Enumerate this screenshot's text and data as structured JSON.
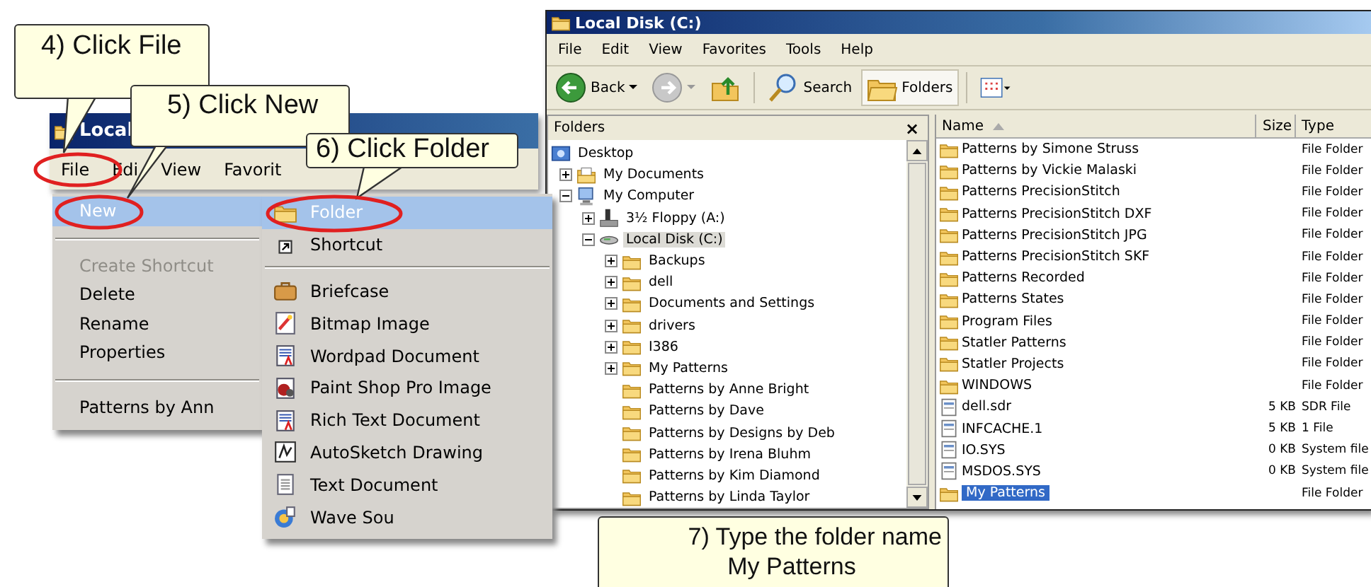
{
  "left_window": {
    "title": "Local",
    "menu": [
      {
        "label": "File"
      },
      {
        "label": "Edi"
      },
      {
        "label": "View"
      },
      {
        "label": "Favorit"
      }
    ],
    "file_menu": [
      {
        "kind": "item",
        "label": "New",
        "selected": true,
        "disabled": false
      },
      {
        "kind": "separator"
      },
      {
        "kind": "item",
        "label": "Create Shortcut",
        "selected": false,
        "disabled": true
      },
      {
        "kind": "item",
        "label": "Delete",
        "selected": false,
        "disabled": false
      },
      {
        "kind": "item",
        "label": "Rename",
        "selected": false,
        "disabled": false
      },
      {
        "kind": "item",
        "label": "Properties",
        "selected": false,
        "disabled": false
      },
      {
        "kind": "separator"
      },
      {
        "kind": "item",
        "label": "Patterns by Ann",
        "selected": false,
        "disabled": false
      }
    ],
    "new_submenu": [
      {
        "kind": "folder",
        "label": "Folder",
        "selected": true
      },
      {
        "kind": "shortcut",
        "label": "Shortcut",
        "selected": false
      },
      {
        "kind": "separator"
      },
      {
        "kind": "briefcase",
        "label": "Briefcase",
        "selected": false
      },
      {
        "kind": "bitmap",
        "label": "Bitmap Image",
        "selected": false
      },
      {
        "kind": "document",
        "label": "Wordpad Document",
        "selected": false
      },
      {
        "kind": "paint",
        "label": "Paint Shop Pro Image",
        "selected": false
      },
      {
        "kind": "document",
        "label": "Rich Text Document",
        "selected": false
      },
      {
        "kind": "sketch",
        "label": "AutoSketch Drawing",
        "selected": false
      },
      {
        "kind": "text",
        "label": "Text Document",
        "selected": false
      },
      {
        "kind": "wave",
        "label": "Wave Sou",
        "selected": false
      }
    ]
  },
  "right_window": {
    "title": "Local Disk (C:)",
    "menu": [
      {
        "label": "File"
      },
      {
        "label": "Edit"
      },
      {
        "label": "View"
      },
      {
        "label": "Favorites"
      },
      {
        "label": "Tools"
      },
      {
        "label": "Help"
      }
    ],
    "toolbar": [
      {
        "kind": "back",
        "label": "Back",
        "pressed": false
      },
      {
        "kind": "forward",
        "pressed": false
      },
      {
        "kind": "up",
        "pressed": false
      },
      {
        "kind": "search",
        "label": "Search",
        "pressed": false
      },
      {
        "kind": "folders",
        "label": "Folders",
        "pressed": true
      },
      {
        "kind": "views",
        "pressed": false
      }
    ],
    "folders_pane": {
      "title": "Folders",
      "close": "×",
      "tree": [
        {
          "label": "Desktop",
          "kind": "desktop",
          "selected": false,
          "children": [
            {
              "label": "My Documents",
              "kind": "documents",
              "expanded": false,
              "selected": false
            },
            {
              "label": "My Computer",
              "kind": "computer",
              "expanded": true,
              "selected": false,
              "children": [
                {
                  "label": "3½ Floppy (A:)",
                  "kind": "floppy",
                  "expanded": false,
                  "selected": false
                },
                {
                  "label": "Local Disk (C:)",
                  "kind": "drive",
                  "expanded": true,
                  "selected": true,
                  "children": [
                    {
                      "label": "Backups",
                      "kind": "folder",
                      "expanded": false,
                      "selected": false
                    },
                    {
                      "label": "dell",
                      "kind": "folder",
                      "expanded": false,
                      "selected": false
                    },
                    {
                      "label": "Documents and Settings",
                      "kind": "folder",
                      "expanded": false,
                      "selected": false
                    },
                    {
                      "label": "drivers",
                      "kind": "folder",
                      "expanded": false,
                      "selected": false
                    },
                    {
                      "label": "I386",
                      "kind": "folder",
                      "expanded": false,
                      "selected": false
                    },
                    {
                      "label": "My Patterns",
                      "kind": "folder",
                      "expanded": false,
                      "selected": false
                    },
                    {
                      "label": "Patterns by Anne Bright",
                      "kind": "folder",
                      "selected": false
                    },
                    {
                      "label": "Patterns by Dave",
                      "kind": "folder",
                      "selected": false
                    },
                    {
                      "label": "Patterns by Designs by Deb",
                      "kind": "folder",
                      "selected": false
                    },
                    {
                      "label": "Patterns by Irena Bluhm",
                      "kind": "folder",
                      "selected": false
                    },
                    {
                      "label": "Patterns by Kim Diamond",
                      "kind": "folder",
                      "selected": false
                    },
                    {
                      "label": "Patterns by Linda Taylor",
                      "kind": "folder",
                      "selected": false
                    }
                  ]
                }
              ]
            }
          ]
        }
      ]
    },
    "file_list": {
      "columns": [
        {
          "label": "Name",
          "sorted": true
        },
        {
          "label": "Size",
          "sorted": false
        },
        {
          "label": "Type",
          "sorted": false
        }
      ],
      "rows": [
        {
          "kind": "folder",
          "name": "Patterns by Simone Struss",
          "type": "File Folder",
          "selected": false
        },
        {
          "kind": "folder",
          "name": "Patterns by Vickie Malaski",
          "type": "File Folder",
          "selected": false
        },
        {
          "kind": "folder",
          "name": "Patterns PrecisionStitch",
          "type": "File Folder",
          "selected": false
        },
        {
          "kind": "folder",
          "name": "Patterns PrecisionStitch DXF",
          "type": "File Folder",
          "selected": false
        },
        {
          "kind": "folder",
          "name": "Patterns PrecisionStitch JPG",
          "type": "File Folder",
          "selected": false
        },
        {
          "kind": "folder",
          "name": "Patterns PrecisionStitch SKF",
          "type": "File Folder",
          "selected": false
        },
        {
          "kind": "folder",
          "name": "Patterns Recorded",
          "type": "File Folder",
          "selected": false
        },
        {
          "kind": "folder",
          "name": "Patterns States",
          "type": "File Folder",
          "selected": false
        },
        {
          "kind": "folder",
          "name": "Program Files",
          "type": "File Folder",
          "selected": false
        },
        {
          "kind": "folder",
          "name": "Statler Patterns",
          "type": "File Folder",
          "selected": false
        },
        {
          "kind": "folder",
          "name": "Statler Projects",
          "type": "File Folder",
          "selected": false
        },
        {
          "kind": "folder",
          "name": "WINDOWS",
          "type": "File Folder",
          "selected": false
        },
        {
          "kind": "file",
          "name": "dell.sdr",
          "size": "5 KB",
          "type": "SDR File",
          "selected": false
        },
        {
          "kind": "file",
          "name": "INFCACHE.1",
          "size": "5 KB",
          "type": "1 File",
          "selected": false
        },
        {
          "kind": "file",
          "name": "IO.SYS",
          "size": "0 KB",
          "type": "System file",
          "selected": false
        },
        {
          "kind": "file",
          "name": "MSDOS.SYS",
          "size": "0 KB",
          "type": "System file",
          "selected": false
        },
        {
          "kind": "folder",
          "name": "My Patterns",
          "type": "File Folder",
          "selected": true
        }
      ]
    }
  },
  "callouts": [
    {
      "lines": [
        "4) Click File"
      ]
    },
    {
      "lines": [
        "5) Click New"
      ]
    },
    {
      "lines": [
        "6) Click Folder"
      ]
    },
    {
      "lines": [
        "7) Type the folder name",
        "My Patterns"
      ]
    }
  ]
}
